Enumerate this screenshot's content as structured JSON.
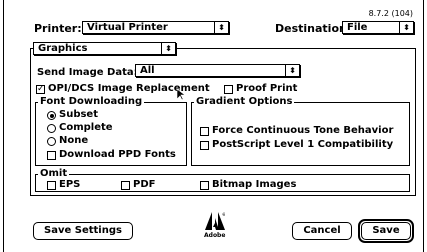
{
  "version": "8.7.2 (104)",
  "printer": {
    "label": "Printer:",
    "value": "Virtual Printer"
  },
  "destination": {
    "label": "Destination:",
    "value": "File"
  },
  "panel_menu": {
    "value": "Graphics"
  },
  "send_image_data": {
    "label": "Send Image Data:",
    "value": "All"
  },
  "opi_label": "OPI/DCS Image Replacement",
  "opi_checked": true,
  "proof_print_label": "Proof Print",
  "proof_print_checked": false,
  "font_downloading": {
    "title": "Font Downloading",
    "options": [
      "Subset",
      "Complete",
      "None"
    ],
    "selected": "Subset",
    "download_ppd_label": "Download PPD Fonts"
  },
  "gradient_options": {
    "title": "Gradient Options",
    "force_continuous_label": "Force Continuous Tone Behavior",
    "postscript_l1_label": "PostScript Level 1 Compatibility"
  },
  "omit": {
    "title": "Omit",
    "eps_label": "EPS",
    "pdf_label": "PDF",
    "bitmap_label": "Bitmap Images"
  },
  "buttons": {
    "save_settings": "Save Settings",
    "cancel": "Cancel",
    "save": "Save"
  },
  "logo_text": "Adobe",
  "icons": {
    "popup_arrow": "updown-arrows-icon",
    "check": "checkmark-icon",
    "cursor": "arrow-cursor-icon",
    "logo": "adobe-logo-icon"
  }
}
